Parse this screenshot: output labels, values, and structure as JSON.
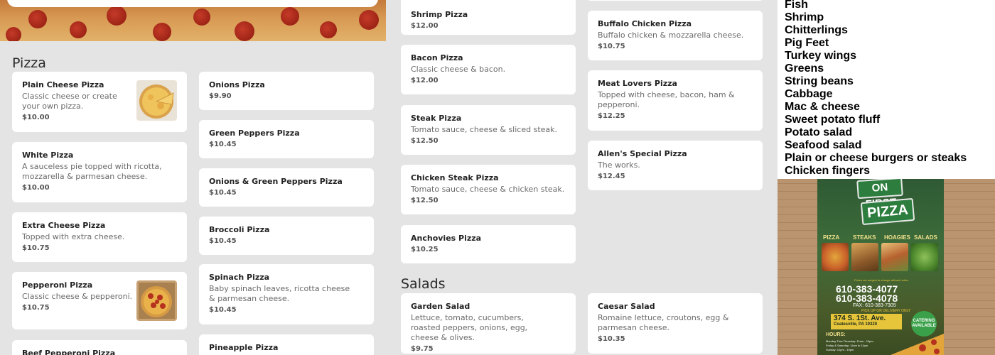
{
  "left": {
    "section_title": "Pizza",
    "col1": [
      {
        "name": "Plain Cheese Pizza",
        "desc": "Classic cheese or create your own pizza.",
        "price": "$10.00"
      },
      {
        "name": "White Pizza",
        "desc": "A sauceless pie topped with ricotta, mozzarella & parmesan cheese.",
        "price": "$10.00"
      },
      {
        "name": "Extra Cheese Pizza",
        "desc": "Topped with extra cheese.",
        "price": "$10.75"
      },
      {
        "name": "Pepperoni Pizza",
        "desc": "Classic cheese & pepperoni.",
        "price": "$10.75"
      },
      {
        "name": "Beef Pepperoni Pizza"
      }
    ],
    "col2": [
      {
        "name": "Onions Pizza",
        "price": "$9.90"
      },
      {
        "name": "Green Peppers Pizza",
        "price": "$10.45"
      },
      {
        "name": "Onions & Green Peppers Pizza",
        "price": "$10.45"
      },
      {
        "name": "Broccoli Pizza",
        "price": "$10.45"
      },
      {
        "name": "Spinach Pizza",
        "desc": "Baby spinach leaves, ricotta cheese & parmesan cheese.",
        "price": "$10.45"
      },
      {
        "name": "Pineapple Pizza"
      }
    ]
  },
  "mid": {
    "col1": [
      {
        "name": "Shrimp Pizza",
        "price": "$12.00"
      },
      {
        "name": "Bacon Pizza",
        "desc": "Classic cheese & bacon.",
        "price": "$12.00"
      },
      {
        "name": "Steak Pizza",
        "desc": "Tomato sauce, cheese & sliced steak.",
        "price": "$12.50"
      },
      {
        "name": "Chicken Steak Pizza",
        "desc": "Tomato sauce, cheese & chicken steak.",
        "price": "$12.50"
      },
      {
        "name": "Anchovies Pizza",
        "price": "$10.25"
      }
    ],
    "col2": [
      {
        "name": "Buffalo Chicken Pizza",
        "desc": "Buffalo chicken & mozzarella cheese.",
        "price": "$10.75"
      },
      {
        "name": "Meat Lovers Pizza",
        "desc": "Topped with cheese, bacon, ham & pepperoni.",
        "price": "$12.25"
      },
      {
        "name": "Allen's Special Pizza",
        "desc": "The works.",
        "price": "$12.45"
      }
    ],
    "salads_title": "Salads",
    "salads": [
      {
        "name": "Garden Salad",
        "desc": "Lettuce, tomato, cucumbers, roasted peppers, onions, egg, cheese & olives.",
        "price": "$9.75"
      },
      {
        "name": "Caesar Salad",
        "desc": "Romaine lettuce, croutons, egg & parmesan cheese.",
        "price": "$10.35"
      }
    ]
  },
  "right": {
    "list": [
      "Fish",
      "Shrimp",
      "Chitterlings",
      "Pig Feet",
      "Turkey wings",
      "Greens",
      "String beans",
      "Cabbage",
      "Mac & cheese",
      "Sweet potato fluff",
      "Potato salad",
      "Seafood salad",
      "Plain or cheese burgers or steaks",
      "Chicken fingers"
    ],
    "flyer": {
      "sign_top": "ON FIRST",
      "sign_main": "PIZZA",
      "categories": [
        "PIZZA",
        "STEAKS",
        "HOAGIES",
        "SALADS"
      ],
      "notice": "Prices are subject to change without notice",
      "phone1": "610-383-4077",
      "phone2": "610-383-4078",
      "fax": "FAX: 610-383-7305",
      "pickup": "PICK UP OR DELIVERY ONLY",
      "address_line1": "374 S. 1St. Ave.",
      "address_line2": "Coatesville, PA 19320",
      "catering": "CATERING AVAILABLE",
      "hours_title": "HOURS:",
      "hours": [
        "Monday Thru Thursday: 11am - 10pm",
        "Friday & Saturday: 11am to 11pm",
        "Sunday: 12pm - 10pm"
      ]
    }
  },
  "colors": {
    "background": "#e4e4e4",
    "card": "#ffffff",
    "flyer_green": "#2c7d3e",
    "flyer_yellow": "#e6c53a"
  }
}
